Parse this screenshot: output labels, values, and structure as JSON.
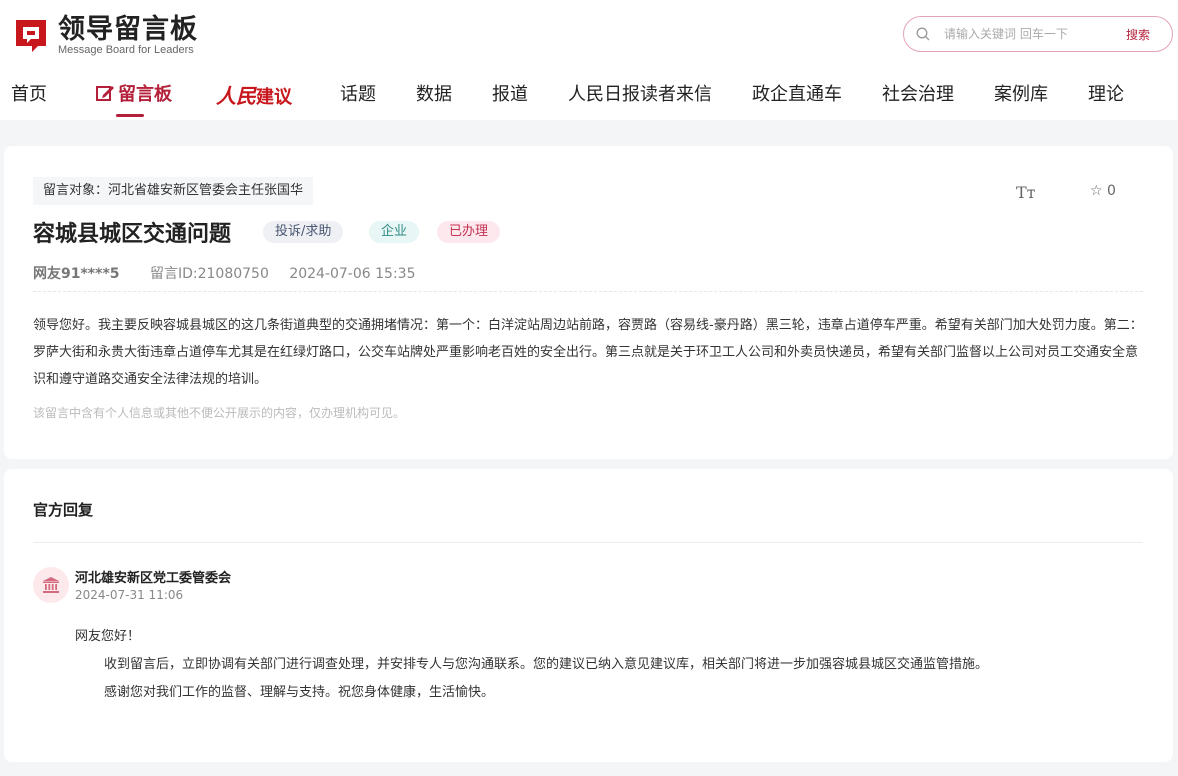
{
  "logo": {
    "cn": "领导留言板",
    "en": "Message Board for Leaders"
  },
  "search": {
    "placeholder": "请输入关键词 回车一下",
    "button": "搜索"
  },
  "nav": {
    "home": "首页",
    "board": "留言板",
    "renmin": "人民",
    "jianyi": "建议",
    "topics": "话题",
    "data": "数据",
    "reports": "报道",
    "letters": "人民日报读者来信",
    "enterprise": "政企直通车",
    "governance": "社会治理",
    "cases": "案例库",
    "theory": "理论"
  },
  "colors": {
    "accent": "#b4203a",
    "renmin_red": "#c8161d"
  },
  "message": {
    "target": "留言对象：河北省雄安新区管委会主任张国华",
    "font_icon_label": "Tт",
    "star_count": "0",
    "title": "容城县城区交通问题",
    "tags": [
      "投诉/求助",
      "企业",
      "已办理"
    ],
    "user": "网友91****5",
    "id": "留言ID:21080750",
    "time": "2024-07-06 15:35",
    "content": "领导您好。我主要反映容城县城区的这几条街道典型的交通拥堵情况：第一个：白洋淀站周边站前路，容贾路（容易线-豪丹路）黑三轮，违章占道停车严重。希望有关部门加大处罚力度。第二：罗萨大街和永贵大街违章占道停车尤其是在红绿灯路口，公交车站牌处严重影响老百姓的安全出行。第三点就是关于环卫工人公司和外卖员快递员，希望有关部门监督以上公司对员工交通安全意识和遵守道路交通安全法律法规的培训。",
    "privacy_note": "该留言中含有个人信息或其他不便公开展示的内容，仅办理机构可见。"
  },
  "reply": {
    "section_title": "官方回复",
    "org": "河北雄安新区党工委管委会",
    "time": "2024-07-31 11:06",
    "greeting": "网友您好！",
    "paragraph1": "收到留言后，立即协调有关部门进行调查处理，并安排专人与您沟通联系。您的建议已纳入意见建议库，相关部门将进一步加强容城县城区交通监管措施。",
    "paragraph2": "感谢您对我们工作的监督、理解与支持。祝您身体健康，生活愉快。"
  }
}
